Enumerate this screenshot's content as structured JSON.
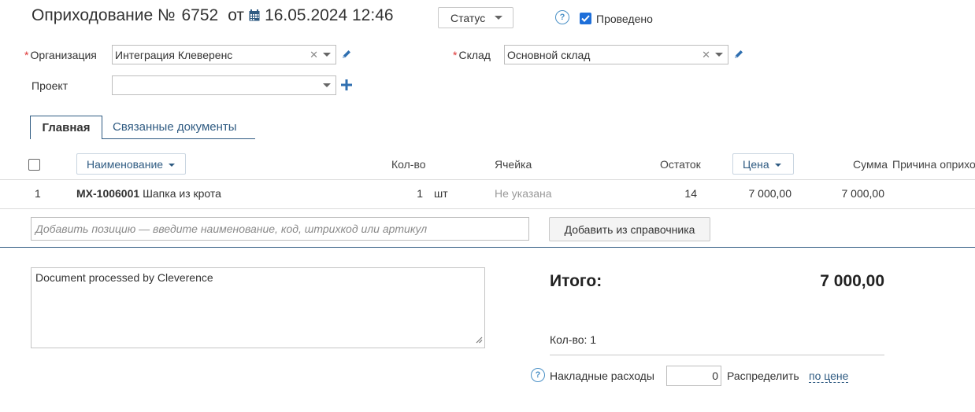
{
  "header": {
    "doc_type": "Оприходование №",
    "doc_number": "6752",
    "date_prefix": "от",
    "date": "16.05.2024 12:46",
    "status_button": "Статус",
    "posted_label": "Проведено",
    "posted_checked": true,
    "help_icon": "?"
  },
  "form": {
    "organization_label": "Организация",
    "organization_value": "Интеграция Клеверенс",
    "warehouse_label": "Склад",
    "warehouse_value": "Основной склад",
    "project_label": "Проект",
    "project_value": "",
    "required_mark": "*"
  },
  "tabs": [
    {
      "label": "Главная",
      "active": true
    },
    {
      "label": "Связанные документы",
      "active": false
    }
  ],
  "table": {
    "columns": {
      "name": "Наименование",
      "qty": "Кол-во",
      "cell": "Ячейка",
      "stock": "Остаток",
      "price": "Цена",
      "sum": "Сумма",
      "reason": "Причина оприхо,"
    },
    "rows": [
      {
        "index": "1",
        "code": "MX-1006001",
        "name": "Шапка из крота",
        "qty": "1",
        "unit": "шт",
        "cell": "Не указана",
        "stock": "14",
        "price": "7 000,00",
        "sum": "7 000,00"
      }
    ],
    "add_placeholder": "Добавить позицию — введите наименование, код, штрихкод или артикул",
    "add_from_catalog": "Добавить из справочника"
  },
  "footer": {
    "comment": "Document processed by Cleverence",
    "total_label": "Итого:",
    "total_value": "7 000,00",
    "qty_summary": "Кол-во: 1",
    "overhead_label": "Накладные расходы",
    "overhead_value": "0",
    "distribute_label": "Распределить",
    "distribute_link": "по цене"
  },
  "colors": {
    "accent": "#2f5b82",
    "checkbox": "#1e6fd9",
    "required": "#dd3333"
  }
}
